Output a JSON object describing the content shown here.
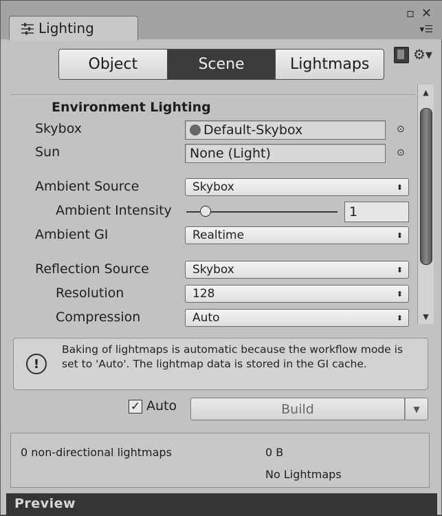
{
  "window": {
    "tab_title": "Lighting",
    "window_controls": "▫ ✕"
  },
  "mode_tabs": [
    {
      "label": "Object",
      "active": false
    },
    {
      "label": "Scene",
      "active": true
    },
    {
      "label": "Lightmaps",
      "active": false
    }
  ],
  "environment": {
    "section_title": "Environment Lighting",
    "skybox_label": "Skybox",
    "skybox_value": "Default-Skybox",
    "sun_label": "Sun",
    "sun_value": "None (Light)",
    "ambient_source_label": "Ambient Source",
    "ambient_source_value": "Skybox",
    "ambient_intensity_label": "Ambient Intensity",
    "ambient_intensity_value": "1",
    "ambient_intensity_slider": 0.1,
    "ambient_gi_label": "Ambient GI",
    "ambient_gi_value": "Realtime",
    "reflection_source_label": "Reflection Source",
    "reflection_source_value": "Skybox",
    "resolution_label": "Resolution",
    "resolution_value": "128",
    "compression_label": "Compression",
    "compression_value": "Auto"
  },
  "info": {
    "message": "Baking of lightmaps is automatic because the workflow mode is set to 'Auto'. The lightmap data is stored in the GI cache."
  },
  "bake": {
    "auto_label": "Auto",
    "auto_checked": true,
    "build_label": "Build"
  },
  "stats": {
    "lightmap_count": "0 non-directional lightmaps",
    "size": "0 B",
    "status": "No Lightmaps"
  },
  "preview": {
    "label": "Preview"
  }
}
